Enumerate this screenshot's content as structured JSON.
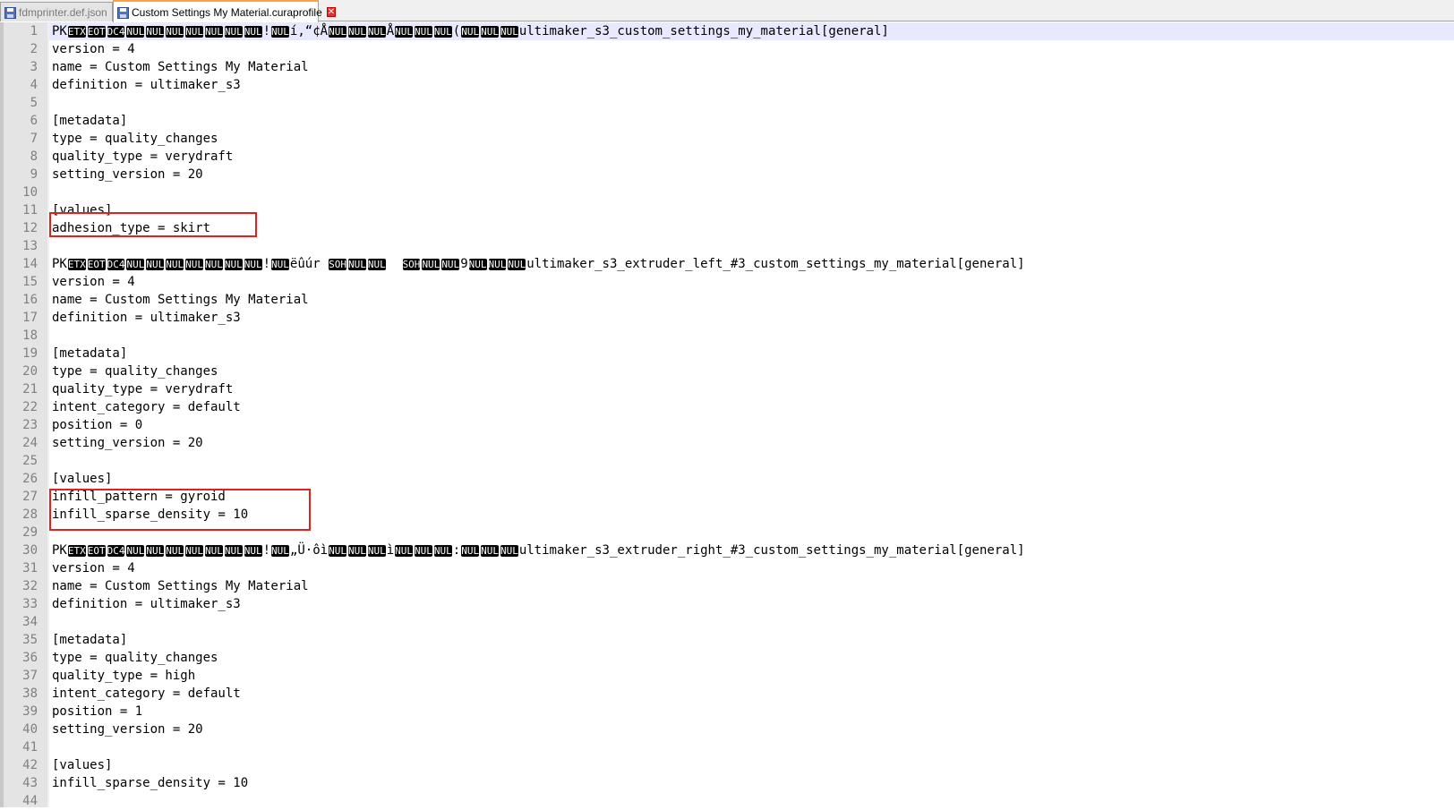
{
  "tabs": [
    {
      "label": "fdmprinter.def.json",
      "active": false
    },
    {
      "label": "Custom Settings My Material.curaprofile",
      "active": true
    }
  ],
  "editor": {
    "lines": [
      {
        "n": "1",
        "segs": [
          {
            "t": "PK"
          },
          {
            "c": "ETX"
          },
          {
            "c": "EOT"
          },
          {
            "c": "DC4"
          },
          {
            "c": "NUL"
          },
          {
            "c": "NUL"
          },
          {
            "c": "NUL"
          },
          {
            "c": "NUL"
          },
          {
            "c": "NUL"
          },
          {
            "c": "NUL"
          },
          {
            "c": "NUL"
          },
          {
            "t": "!"
          },
          {
            "c": "NUL"
          },
          {
            "t": "í,“¢Å"
          },
          {
            "c": "NUL"
          },
          {
            "c": "NUL"
          },
          {
            "c": "NUL"
          },
          {
            "t": "Å"
          },
          {
            "c": "NUL"
          },
          {
            "c": "NUL"
          },
          {
            "c": "NUL"
          },
          {
            "t": "("
          },
          {
            "c": "NUL"
          },
          {
            "c": "NUL"
          },
          {
            "c": "NUL"
          },
          {
            "t": "ultimaker_s3_custom_settings_my_material[general]"
          }
        ]
      },
      {
        "n": "2",
        "segs": [
          {
            "t": "version = 4"
          }
        ]
      },
      {
        "n": "3",
        "segs": [
          {
            "t": "name = Custom Settings My Material"
          }
        ]
      },
      {
        "n": "4",
        "segs": [
          {
            "t": "definition = ultimaker_s3"
          }
        ]
      },
      {
        "n": "5",
        "segs": []
      },
      {
        "n": "6",
        "segs": [
          {
            "t": "[metadata]"
          }
        ]
      },
      {
        "n": "7",
        "segs": [
          {
            "t": "type = quality_changes"
          }
        ]
      },
      {
        "n": "8",
        "segs": [
          {
            "t": "quality_type = verydraft"
          }
        ]
      },
      {
        "n": "9",
        "segs": [
          {
            "t": "setting_version = 20"
          }
        ]
      },
      {
        "n": "10",
        "segs": []
      },
      {
        "n": "11",
        "segs": [
          {
            "t": "[values]"
          }
        ]
      },
      {
        "n": "12",
        "segs": [
          {
            "t": "adhesion_type = skirt"
          }
        ]
      },
      {
        "n": "13",
        "segs": []
      },
      {
        "n": "14",
        "segs": [
          {
            "t": "PK"
          },
          {
            "c": "ETX"
          },
          {
            "c": "EOT"
          },
          {
            "c": "DC4"
          },
          {
            "c": "NUL"
          },
          {
            "c": "NUL"
          },
          {
            "c": "NUL"
          },
          {
            "c": "NUL"
          },
          {
            "c": "NUL"
          },
          {
            "c": "NUL"
          },
          {
            "c": "NUL"
          },
          {
            "t": "!"
          },
          {
            "c": "NUL"
          },
          {
            "t": "ëûúr "
          },
          {
            "c": "SOH"
          },
          {
            "c": "NUL"
          },
          {
            "c": "NUL"
          },
          {
            "t": "  "
          },
          {
            "c": "SOH"
          },
          {
            "c": "NUL"
          },
          {
            "c": "NUL"
          },
          {
            "t": "9"
          },
          {
            "c": "NUL"
          },
          {
            "c": "NUL"
          },
          {
            "c": "NUL"
          },
          {
            "t": "ultimaker_s3_extruder_left_#3_custom_settings_my_material[general]"
          }
        ]
      },
      {
        "n": "15",
        "segs": [
          {
            "t": "version = 4"
          }
        ]
      },
      {
        "n": "16",
        "segs": [
          {
            "t": "name = Custom Settings My Material"
          }
        ]
      },
      {
        "n": "17",
        "segs": [
          {
            "t": "definition = ultimaker_s3"
          }
        ]
      },
      {
        "n": "18",
        "segs": []
      },
      {
        "n": "19",
        "segs": [
          {
            "t": "[metadata]"
          }
        ]
      },
      {
        "n": "20",
        "segs": [
          {
            "t": "type = quality_changes"
          }
        ]
      },
      {
        "n": "21",
        "segs": [
          {
            "t": "quality_type = verydraft"
          }
        ]
      },
      {
        "n": "22",
        "segs": [
          {
            "t": "intent_category = default"
          }
        ]
      },
      {
        "n": "23",
        "segs": [
          {
            "t": "position = 0"
          }
        ]
      },
      {
        "n": "24",
        "segs": [
          {
            "t": "setting_version = 20"
          }
        ]
      },
      {
        "n": "25",
        "segs": []
      },
      {
        "n": "26",
        "segs": [
          {
            "t": "[values]"
          }
        ]
      },
      {
        "n": "27",
        "segs": [
          {
            "t": "infill_pattern = gyroid"
          }
        ]
      },
      {
        "n": "28",
        "segs": [
          {
            "t": "infill_sparse_density = 10"
          }
        ]
      },
      {
        "n": "29",
        "segs": []
      },
      {
        "n": "30",
        "segs": [
          {
            "t": "PK"
          },
          {
            "c": "ETX"
          },
          {
            "c": "EOT"
          },
          {
            "c": "DC4"
          },
          {
            "c": "NUL"
          },
          {
            "c": "NUL"
          },
          {
            "c": "NUL"
          },
          {
            "c": "NUL"
          },
          {
            "c": "NUL"
          },
          {
            "c": "NUL"
          },
          {
            "c": "NUL"
          },
          {
            "t": "!"
          },
          {
            "c": "NUL"
          },
          {
            "t": "„Ü·ôì"
          },
          {
            "c": "NUL"
          },
          {
            "c": "NUL"
          },
          {
            "c": "NUL"
          },
          {
            "t": "ì"
          },
          {
            "c": "NUL"
          },
          {
            "c": "NUL"
          },
          {
            "c": "NUL"
          },
          {
            "t": ":"
          },
          {
            "c": "NUL"
          },
          {
            "c": "NUL"
          },
          {
            "c": "NUL"
          },
          {
            "t": "ultimaker_s3_extruder_right_#3_custom_settings_my_material[general]"
          }
        ]
      },
      {
        "n": "31",
        "segs": [
          {
            "t": "version = 4"
          }
        ]
      },
      {
        "n": "32",
        "segs": [
          {
            "t": "name = Custom Settings My Material"
          }
        ]
      },
      {
        "n": "33",
        "segs": [
          {
            "t": "definition = ultimaker_s3"
          }
        ]
      },
      {
        "n": "34",
        "segs": []
      },
      {
        "n": "35",
        "segs": [
          {
            "t": "[metadata]"
          }
        ]
      },
      {
        "n": "36",
        "segs": [
          {
            "t": "type = quality_changes"
          }
        ]
      },
      {
        "n": "37",
        "segs": [
          {
            "t": "quality_type = high"
          }
        ]
      },
      {
        "n": "38",
        "segs": [
          {
            "t": "intent_category = default"
          }
        ]
      },
      {
        "n": "39",
        "segs": [
          {
            "t": "position = 1"
          }
        ]
      },
      {
        "n": "40",
        "segs": [
          {
            "t": "setting_version = 20"
          }
        ]
      },
      {
        "n": "41",
        "segs": []
      },
      {
        "n": "42",
        "segs": [
          {
            "t": "[values]"
          }
        ]
      },
      {
        "n": "43",
        "segs": [
          {
            "t": "infill_sparse_density = 10"
          }
        ]
      },
      {
        "n": "44",
        "segs": []
      }
    ]
  },
  "annotations": {
    "color": "#e32020",
    "highlighted_lines": [
      [
        "12"
      ],
      [
        "27",
        "28"
      ]
    ]
  }
}
